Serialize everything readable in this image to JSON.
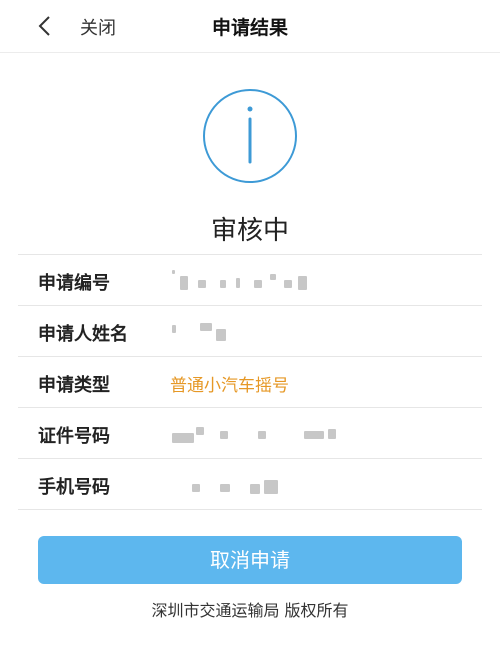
{
  "nav": {
    "back_icon": "chevron-left-icon",
    "close_label": "关闭",
    "title": "申请结果"
  },
  "status": {
    "icon": "info-circle-icon",
    "icon_color": "#3d9ad6",
    "text": "审核中"
  },
  "fields": [
    {
      "label": "申请编号"
    },
    {
      "label": "申请人姓名"
    },
    {
      "label": "申请类型",
      "value": "普通小汽车摇号",
      "value_color": "#e69826"
    },
    {
      "label": "证件号码"
    },
    {
      "label": "手机号码"
    }
  ],
  "cancel_button": {
    "label": "取消申请",
    "color": "#5db7ee"
  },
  "footer": "深圳市交通运输局 版权所有"
}
